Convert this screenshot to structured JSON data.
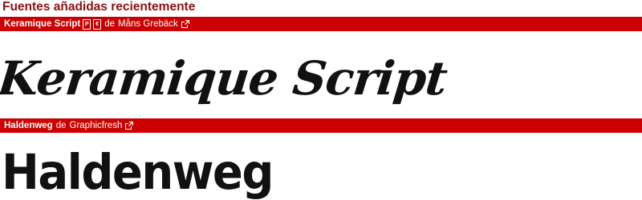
{
  "page": {
    "section_title": "Fuentes añadidas recientemente"
  },
  "fonts": [
    {
      "name": "Keramique Script",
      "by_label": "de",
      "author": "Måns Grebäck",
      "badges": [
        "P",
        "€"
      ],
      "preview_text": "Keramique Script",
      "bar_color": "#cc0000"
    },
    {
      "name": "Haldenweg",
      "by_label": "de",
      "author": "Graphicfresh",
      "badges": [],
      "preview_text": "Haldenweg",
      "bar_color": "#cc0000"
    }
  ],
  "icons": {
    "external_link": "external-link-icon"
  },
  "colors": {
    "title": "#8b1111",
    "bar": "#cc0000",
    "preview_ink": "#111111"
  }
}
